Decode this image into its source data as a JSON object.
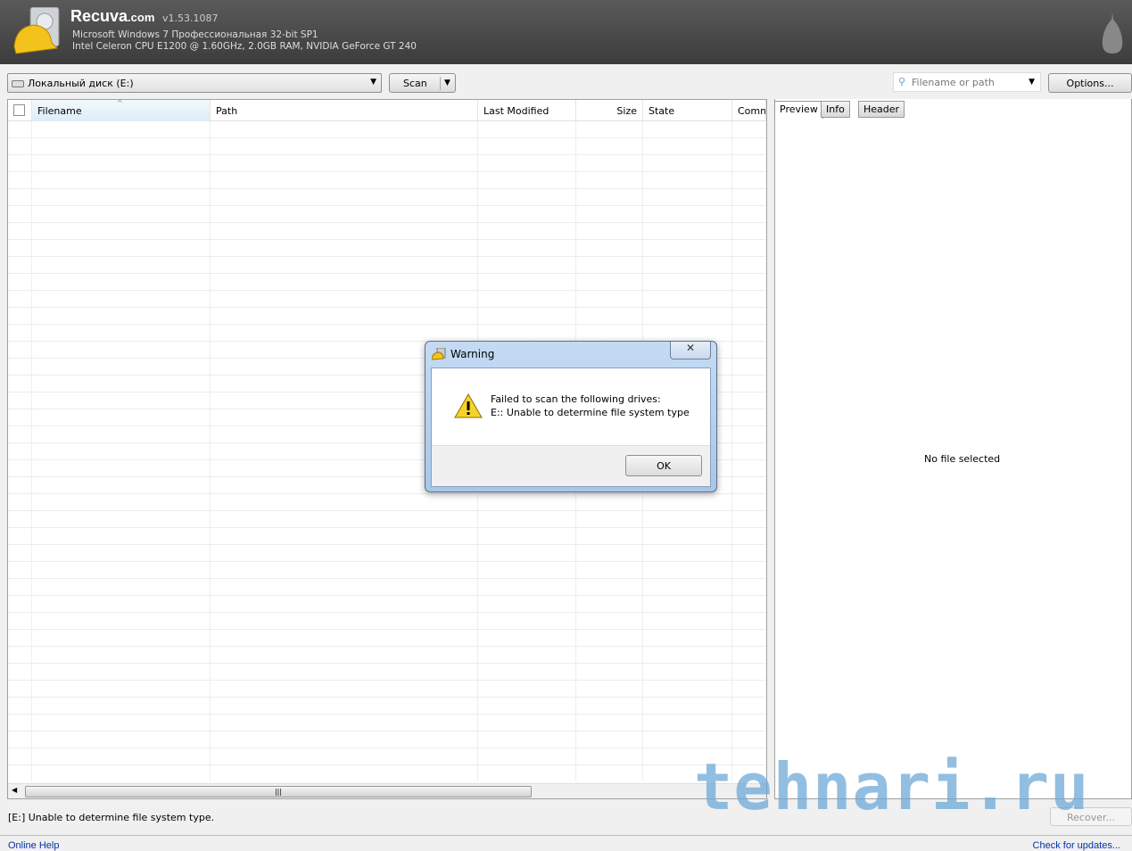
{
  "header": {
    "app_name": "Recuva",
    "app_domain": ".com",
    "version": "v1.53.1087",
    "os": "Microsoft Windows 7 Профессиональная 32-bit SP1",
    "hardware": "Intel Celeron CPU E1200 @ 1.60GHz, 2.0GB RAM, NVIDIA GeForce GT 240"
  },
  "toolbar": {
    "drive": "Локальный диск (E:)",
    "scan": "Scan",
    "search_placeholder": "Filename or path",
    "options": "Options..."
  },
  "table": {
    "columns": [
      "Filename",
      "Path",
      "Last Modified",
      "Size",
      "State",
      "Comn"
    ]
  },
  "preview": {
    "tabs": [
      "Preview",
      "Info",
      "Header"
    ],
    "empty_text": "No file selected"
  },
  "status": {
    "text": "[E:] Unable to determine file system type.",
    "recover": "Recover...",
    "online_help": "Online Help",
    "check_updates": "Check for updates..."
  },
  "dialog": {
    "title": "Warning",
    "line1": "Failed to scan the following drives:",
    "line2": "E:: Unable to determine file system type",
    "ok": "OK"
  },
  "watermark": "tehnari.ru",
  "colors": {
    "header_bg": "#4a4a4a",
    "link": "#0033aa",
    "sorted_header": "#dcedf8"
  }
}
